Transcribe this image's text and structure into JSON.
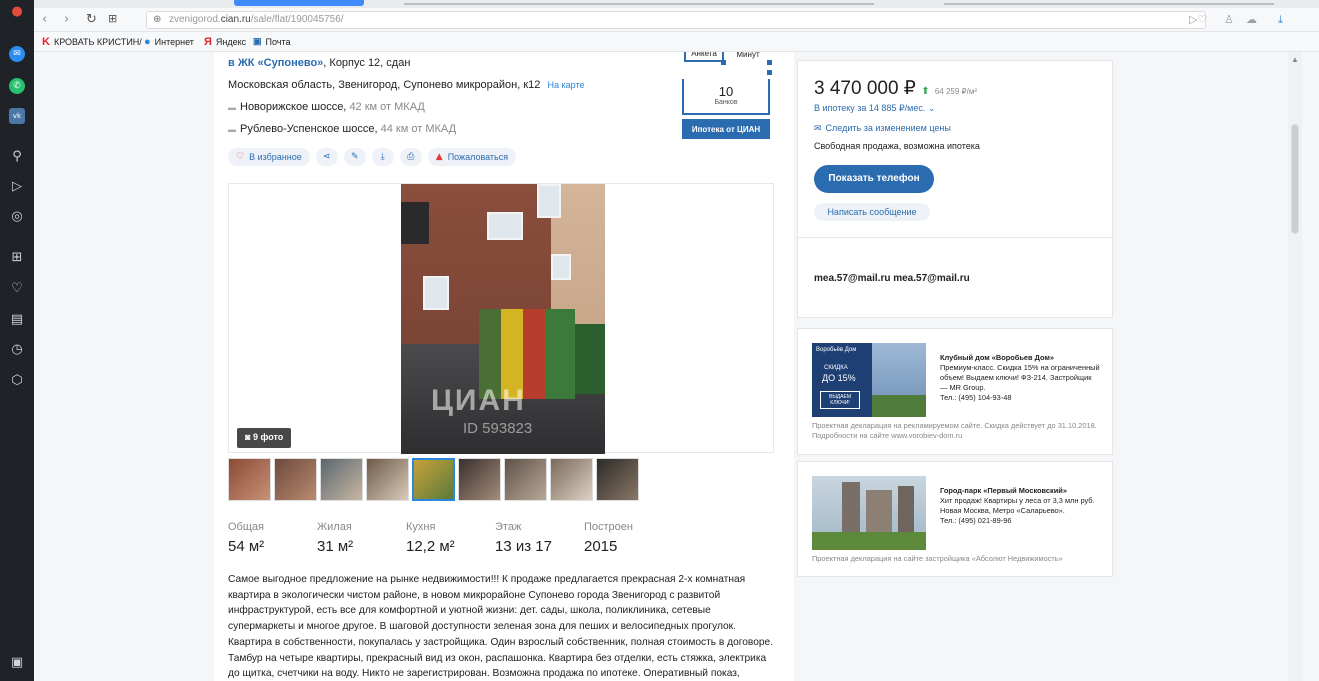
{
  "colors": {
    "accent": "#2b6cb0",
    "link": "#2b87db",
    "dock": "#1f2226",
    "price_up": "#2ea84a"
  },
  "browser": {
    "url_host": "zvenigorod.cian.ru",
    "url_path": "/sale/flat/190045756/",
    "url_prefix": "zvenigorod."
  },
  "bookmarks": [
    {
      "label": "КРОВАТЬ КРИСТИН/",
      "icon": "k-logo-icon"
    },
    {
      "label": "Интернет",
      "icon": "globe-icon"
    },
    {
      "label": "Яндекс",
      "icon": "yandex-icon"
    },
    {
      "label": "Почта",
      "icon": "mail-icon"
    }
  ],
  "listing": {
    "complex_prefix": "в ЖК «Сyпонево»",
    "complex_suffix": ", Корпус 12, сдан",
    "address": "Московская область, Звенигород, Супонево микрорайон, к12",
    "map_link": "На карте",
    "highways": [
      {
        "name": "Новорижское шоссе,",
        "distance": "42 км от МКАД"
      },
      {
        "name": "Рублево-Успенское шоссе,",
        "distance": "44 км от МКАД"
      }
    ],
    "anketa_label": "Анкета",
    "minutes_label": "Минут",
    "banks_count": "10",
    "banks_label": "Банков",
    "mortgage_button": "Ипотека от ЦИАН",
    "actions": {
      "favorite": "В избранное",
      "complain": "Пожаловаться"
    },
    "photo_count": "9 фото",
    "watermark": "ЦИАН",
    "watermark_id": "ID 593823",
    "stats": [
      {
        "label": "Общая",
        "value": "54 м²"
      },
      {
        "label": "Жилая",
        "value": "31 м²"
      },
      {
        "label": "Кухня",
        "value": "12,2 м²"
      },
      {
        "label": "Этаж",
        "value": "13 из 17"
      },
      {
        "label": "Построен",
        "value": "2015"
      }
    ],
    "description": "Самое выгодное предложение на рынке недвижимости!!! К продаже предлагается прекрасная 2-х комнатная квартира в экологически чистом районе, в новом микрорайоне Супонево города Звенигород с развитой инфраструктурой, есть все для комфортной и уютной жизни: дет. сады, школа, поликлиника, сетевые супермаркеты и многое другое. В шаговой доступности зеленая зона для пеших и велосипедных прогулок. Квартира в собственности, покупалась у застройщика. Один взрослый собственник, полная стоимость в договоре. Тамбур на четыре квартиры, прекрасный вид из окон, распашонка. Квартира без отделки, есть стяжка, электрика до щитка, счетчики на воду. Никто не зарегистрирован. Возможна продажа по ипотеке. Оперативный показ, быстрый выход на сделку. Звоните!!! Ждем!!!"
  },
  "sidebar": {
    "price": "3 470 000 ₽",
    "price_per_sqm": "64 259 ₽/м²",
    "mortgage": "В ипотеку за 14 885 ₽/мес.",
    "follow": "Следить за изменением цены",
    "sale_type": "Свободная продажа, возможна ипотека",
    "phone_button": "Показать телефон",
    "message_button": "Написать сообщение",
    "email": "mea.57@mail.ru mea.57@mail.ru"
  },
  "ads": [
    {
      "img_caption_1": "Воробьёв Дом",
      "img_caption_2": "СКИДКА",
      "img_caption_3": "ДО 15%",
      "img_caption_4": "ВЫДАЕМ КЛЮЧИ!",
      "title": "Клубный дом «Воробьев Дом»",
      "body": "Премиум-класс. Скидка 15% на ограниченный объем! Выдаем ключи! ФЗ-214. Застройщик — MR Group.",
      "phone": "Тел.: (495) 104-93-48",
      "note": "Проектная декларация на рекламируемом сайте. Скидка действует до 31.10.2018. Подробности на сайте www.vorobiev-dom.ru"
    },
    {
      "title": "Город-парк «Первый Московский»",
      "body": "Хит продаж! Квартиры у леса от 3,3 млн руб. Новая Москва, Метро «Саларьево».",
      "phone": "Тел.: (495) 021-89-96",
      "note": "Проектная декларация на сайте застройщика «Абсолют Недвижимость»"
    }
  ]
}
